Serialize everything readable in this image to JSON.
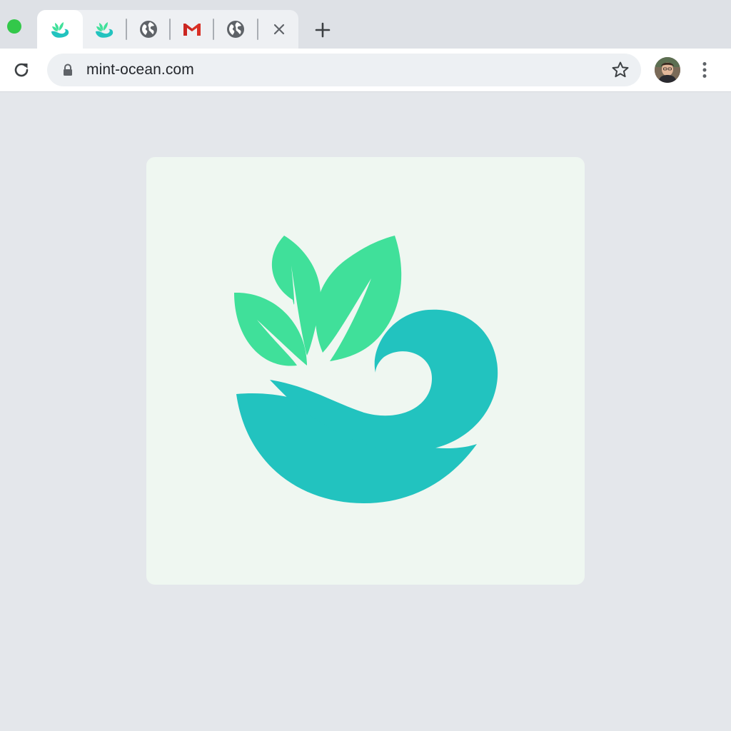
{
  "browser": {
    "window_control": "traffic-light-green",
    "tabs": [
      {
        "icon": "mint-ocean-favicon",
        "active": true
      },
      {
        "icon": "mint-ocean-favicon",
        "active": false
      },
      {
        "icon": "globe-icon",
        "active": false
      },
      {
        "icon": "gmail-icon",
        "active": false
      },
      {
        "icon": "globe-icon",
        "active": false
      }
    ],
    "tab_close_icon": "close-icon",
    "new_tab_icon": "plus-icon",
    "address_bar": {
      "url": "mint-ocean.com",
      "security_icon": "lock-icon",
      "bookmark_icon": "star-icon"
    },
    "profile_icon": "avatar",
    "menu_icon": "more-vert-icon"
  },
  "page": {
    "logo": {
      "name": "mint-ocean-logo",
      "leaf_color": "#40e09a",
      "wave_color": "#22c3bf",
      "background": "#eff7f1"
    }
  },
  "colors": {
    "tabstrip": "#dee1e6",
    "toolbar": "#ffffff",
    "omnibox": "#edf0f3",
    "page_background": "#e4e7eb",
    "traffic_light": "#33c84a",
    "gmail_red": "#d93025"
  }
}
